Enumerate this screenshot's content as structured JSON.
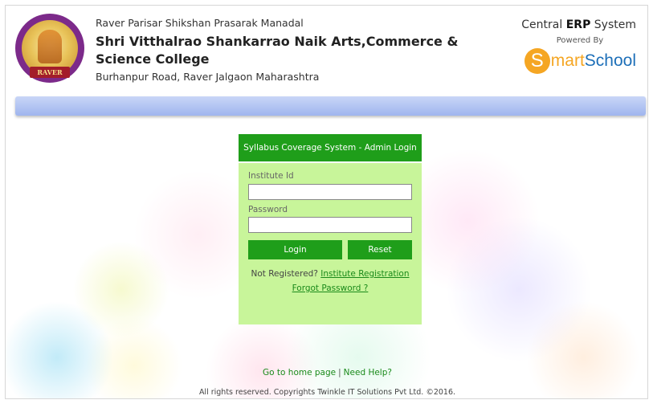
{
  "header": {
    "logo_text": "RAVER",
    "society": "Raver Parisar Shikshan Prasarak Manadal",
    "college": "Shri Vitthalrao Shankarrao Naik Arts,Commerce & Science College",
    "address": "Burhanpur Road, Raver Jalgaon Maharashtra"
  },
  "erp": {
    "prefix": "Central",
    "bold": "ERP",
    "suffix": "System",
    "powered_by": "Powered By",
    "brand_s": "S",
    "brand_mart": "mart",
    "brand_school": "School"
  },
  "login": {
    "title": "Syllabus Coverage System - Admin Login",
    "institute_label": "Institute Id",
    "institute_value": "",
    "password_label": "Password",
    "password_value": "",
    "login_button": "Login",
    "reset_button": "Reset",
    "not_registered": "Not Registered?",
    "register_link": "Institute Registration",
    "forgot_link": "Forgot Password ?"
  },
  "footer": {
    "home_link": "Go to home page",
    "separator": "|",
    "help_link": "Need Help?",
    "copyright": "All rights reserved. Copyrights Twinkle IT Solutions Pvt Ltd. ©2016."
  },
  "colors": {
    "green": "#1f9e1a",
    "panel": "#c8f59a",
    "navbar": "#b3c6f2",
    "brand_orange": "#f5a623",
    "brand_blue": "#1d6fb8"
  }
}
